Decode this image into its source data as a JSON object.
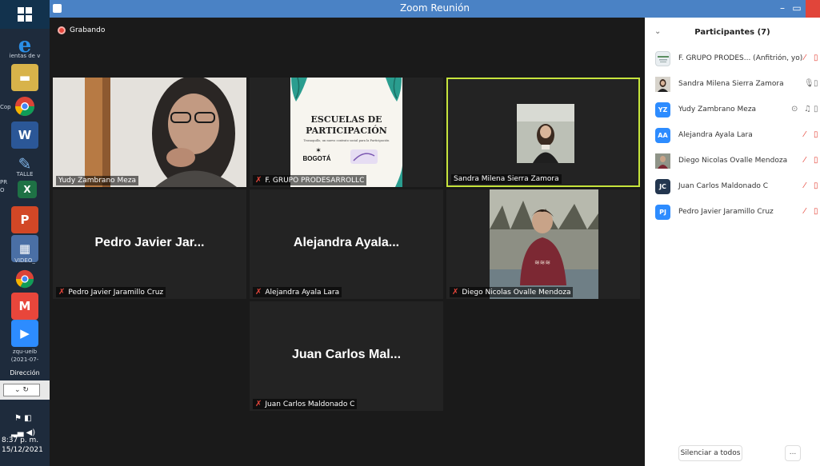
{
  "window": {
    "title": "Zoom Reunión"
  },
  "recording": {
    "label": "Grabando"
  },
  "tiles": [
    {
      "name": "Yudy Zambrano Meza",
      "big": "",
      "muted": false
    },
    {
      "name": "F. GRUPO PRODESARROLLC",
      "big": "",
      "muted": true
    },
    {
      "name": "Sandra Milena Sierra Zamora",
      "big": "",
      "muted": false
    },
    {
      "name": "Pedro Javier Jaramillo Cruz",
      "big": "Pedro Javier Jar...",
      "muted": true
    },
    {
      "name": "Alejandra Ayala Lara",
      "big": "Alejandra Ayala...",
      "muted": true
    },
    {
      "name": "Diego Nicolas Ovalle Mendoza",
      "big": "",
      "muted": true
    },
    {
      "name": "Juan Carlos Maldonado C",
      "big": "Juan Carlos Mal...",
      "muted": true
    }
  ],
  "shared_slide": {
    "line1": "ESCUELAS DE",
    "line2": "PARTICIPACIÓN",
    "caption": "Teusaquillo, un nuevo contrato social para la Participación",
    "logo": "BOGOTÁ"
  },
  "participants": {
    "title": "Participantes (7)",
    "items": [
      {
        "initials": "",
        "name": "F. GRUPO PRODES... (Anfitrión, yo)",
        "color": "#e9eef1"
      },
      {
        "initials": "",
        "name": "Sandra Milena Sierra Zamora",
        "color": "#9c7a66"
      },
      {
        "initials": "YZ",
        "name": "Yudy Zambrano Meza",
        "color": "#2d8cff"
      },
      {
        "initials": "AA",
        "name": "Alejandra Ayala Lara",
        "color": "#2d8cff"
      },
      {
        "initials": "",
        "name": "Diego  Nicolas Ovalle Mendoza",
        "color": "#6e4b3a"
      },
      {
        "initials": "JC",
        "name": "Juan Carlos Maldonado C",
        "color": "#23364f"
      },
      {
        "initials": "PJ",
        "name": "Pedro Javier Jaramillo Cruz",
        "color": "#2d8cff"
      }
    ],
    "mute_all": "Silenciar a todos",
    "more": "..."
  },
  "taskbar": {
    "labels": [
      "ientas de v",
      "Cop",
      "TALLE",
      "PR",
      "O",
      "VIDEO_",
      "zqu-ueib",
      "(2021-07-",
      "Dirección"
    ],
    "time": "8:37 p. m.",
    "date": "15/12/2021"
  }
}
